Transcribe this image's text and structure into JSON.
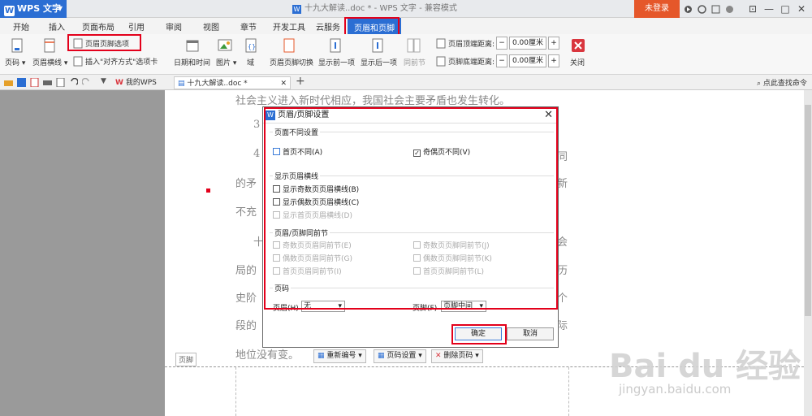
{
  "titlebar": {
    "app_name": "WPS 文字",
    "app_logo": "W",
    "doc_title": "十九大解读..doc * - WPS 文字 - 兼容模式",
    "login": "未登录",
    "icons": [
      "record-icon",
      "skin-icon",
      "document-icon",
      "help-icon",
      "collapse-ribbon-icon"
    ],
    "win_minimize": "—",
    "win_maximize": "□",
    "win_close": "✕"
  },
  "tabs": [
    "开始",
    "插入",
    "页面布局",
    "引用",
    "审阅",
    "视图",
    "章节",
    "开发工具",
    "云服务",
    "页眉和页脚"
  ],
  "ribbon": {
    "page_number": "页码",
    "header_line": "页眉横线",
    "header_footer_options": "页眉页脚选项",
    "insert_align_tab": "插入\"对齐方式\"选项卡",
    "datetime": "日期和时间",
    "picture": "图片",
    "field": "域",
    "switch": "页眉页脚切换",
    "show_prev": "显示前一项",
    "show_next": "显示后一项",
    "same_prev": "同前节",
    "header_top_label": "页眉顶端距离:",
    "header_top_value": "0.00厘米",
    "footer_bottom_label": "页脚底端距离:",
    "footer_bottom_value": "0.00厘米",
    "minus": "−",
    "plus": "+",
    "close": "关闭"
  },
  "quickbar": {
    "tab_mywps": "我的WPS",
    "tab_doc": "十九大解读..doc *",
    "new_tab": "+",
    "search": "点此查找命令"
  },
  "doc": {
    "line1": "社会主义进入新时代相应，我国社会主要矛盾也发生转化。",
    "l2": "3",
    "l3": "4",
    "l3r": "同",
    "l4": "的矛",
    "l4r": "新",
    "l5": "不充",
    "l6": "十",
    "l6r": "会",
    "l7": "局的",
    "l7r": "历",
    "l8": "史阶",
    "l8r": "个",
    "l9": "段的",
    "l9r": "际",
    "l10": "地位没有变。"
  },
  "footer": {
    "label": "页脚",
    "renumber": "重新编号",
    "page_settings": "页码设置",
    "delete_page_num": "删除页码"
  },
  "dialog": {
    "title": "页眉/页脚设置",
    "logo": "W",
    "close": "✕",
    "sec1": "页面不同设置",
    "first_diff": "首页不同(A)",
    "odd_even_diff": "奇偶页不同(V)",
    "check_mark": "✓",
    "sec2": "显示页眉横线",
    "odd_line": "显示奇数页页眉横线(B)",
    "even_line": "显示偶数页页眉横线(C)",
    "first_line": "显示首页页眉横线(D)",
    "sec3": "页眉/页脚同前节",
    "odd_header_same": "奇数页页眉同前节(E)",
    "odd_footer_same": "奇数页页脚同前节(J)",
    "even_header_same": "偶数页页眉同前节(G)",
    "even_footer_same": "偶数页页脚同前节(K)",
    "first_header_same": "首页页眉同前节(I)",
    "first_footer_same": "首页页脚同前节(L)",
    "sec4": "页码",
    "header_label": "页眉(H)",
    "header_value": "无",
    "footer_label": "页脚(F)",
    "footer_value": "页脚中间",
    "dd": "▾",
    "ok": "确定",
    "cancel": "取消"
  },
  "watermark": {
    "brand": "Bai du 经验",
    "url": "jingyan.baidu.com"
  },
  "colors": {
    "accent": "#2b6ed3",
    "highlight": "#e3001b",
    "login": "#e5572a"
  }
}
